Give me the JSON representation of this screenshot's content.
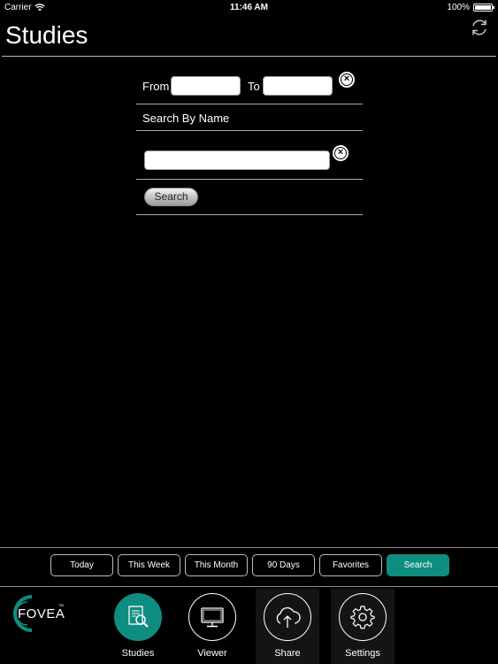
{
  "status_bar": {
    "carrier": "Carrier",
    "time": "11:46 AM",
    "battery": "100%",
    "battery_level": 1.0
  },
  "header": {
    "title": "Studies"
  },
  "search_form": {
    "from_label": "From",
    "from_value": "",
    "to_label": "To",
    "to_value": "",
    "search_by_name_label": "Search By Name",
    "name_value": "",
    "search_button": "Search"
  },
  "filters": [
    {
      "label": "Today",
      "active": false
    },
    {
      "label": "This Week",
      "active": false
    },
    {
      "label": "This Month",
      "active": false
    },
    {
      "label": "90 Days",
      "active": false
    },
    {
      "label": "Favorites",
      "active": false
    },
    {
      "label": "Search",
      "active": true
    }
  ],
  "logo": {
    "text": "FOVEA",
    "mark": "TM"
  },
  "tabs": [
    {
      "label": "Studies",
      "icon": "studies-document-search-icon",
      "active": true
    },
    {
      "label": "Viewer",
      "icon": "monitor-icon",
      "active": false
    },
    {
      "label": "Share",
      "icon": "cloud-upload-icon",
      "active": false
    },
    {
      "label": "Settings",
      "icon": "gear-icon",
      "active": false
    }
  ],
  "colors": {
    "accent": "#0f8d80",
    "background": "#000000"
  }
}
